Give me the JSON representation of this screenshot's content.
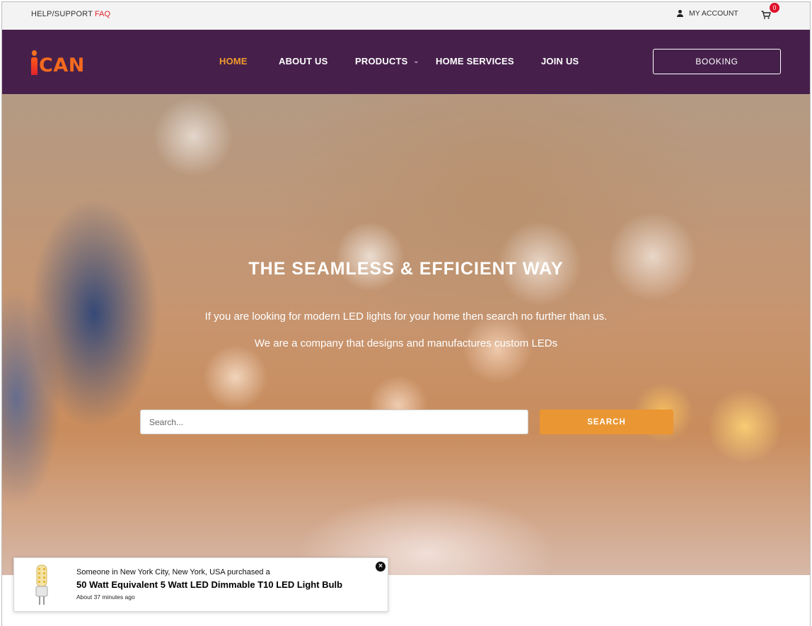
{
  "topbar": {
    "help_label": "HELP/SUPPORT",
    "faq_label": "FAQ",
    "account_label": "MY ACCOUNT",
    "cart_count": "0"
  },
  "nav": {
    "logo_text": "CAN",
    "items": [
      {
        "label": "HOME",
        "active": true
      },
      {
        "label": "ABOUT US",
        "active": false
      },
      {
        "label": "PRODUCTS",
        "active": false,
        "has_dropdown": true
      },
      {
        "label": "HOME SERVICES",
        "active": false
      },
      {
        "label": "JOIN US",
        "active": false
      }
    ],
    "dropdown_glyph": "⌄",
    "booking_label": "BOOKING"
  },
  "hero": {
    "title": "THE SEAMLESS & EFFICIENT WAY",
    "subtitle_1": "If you are looking for modern LED lights for your home then search no further than us.",
    "subtitle_2": "We are a company that designs and manufactures custom LEDs",
    "search_placeholder": "Search...",
    "search_value": "",
    "search_button": "SEARCH"
  },
  "popup": {
    "line1": "Someone in New York City, New York, USA purchased a",
    "product": "50 Watt Equivalent 5 Watt LED Dimmable T10 LED Light Bulb",
    "time": "About 37 minutes ago",
    "close_glyph": "×"
  },
  "colors": {
    "nav_bg": "#46204b",
    "accent_orange": "#ea9632",
    "faq_red": "#e0242a",
    "badge_red": "#e0102a"
  },
  "icons": [
    "user-icon",
    "cart-icon",
    "chevron-down-icon",
    "close-icon",
    "bulb-product-thumbnail"
  ]
}
